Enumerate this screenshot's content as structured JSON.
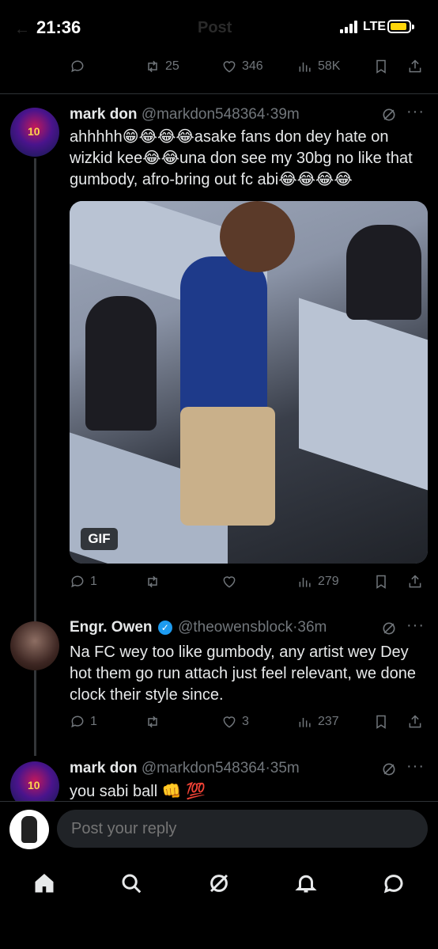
{
  "status_bar": {
    "time": "21:36",
    "network": "LTE",
    "title_faded": "Post"
  },
  "top_actions": {
    "retweets": "25",
    "likes": "346",
    "views": "58K"
  },
  "tweets": [
    {
      "name": "mark don",
      "handle": "@markdon548364",
      "time": "39m",
      "text": "ahhhhh😁😂😂😂asake fans don dey hate on wizkid kee😂😂una don see my 30bg no like that gumbody, afro-bring out fc abi😂😂😂😂",
      "media_badge": "GIF",
      "actions": {
        "replies": "1",
        "retweets": "",
        "likes": "",
        "views": "279"
      }
    },
    {
      "name": "Engr. Owen",
      "handle": "@theowensblock",
      "time": "36m",
      "text": "Na FC wey too like gumbody, any artist wey Dey hot them go run attach just feel relevant, we done clock their style since.",
      "actions": {
        "replies": "1",
        "retweets": "",
        "likes": "3",
        "views": "237"
      }
    },
    {
      "name": "mark don",
      "handle": "@markdon548364",
      "time": "35m",
      "text": "you sabi ball 👊 💯"
    }
  ],
  "reply": {
    "placeholder": "Post your reply"
  },
  "colors": {
    "background": "#000000",
    "muted": "#71767b",
    "accent": "#1d9bf0",
    "divider": "#2f3336"
  }
}
